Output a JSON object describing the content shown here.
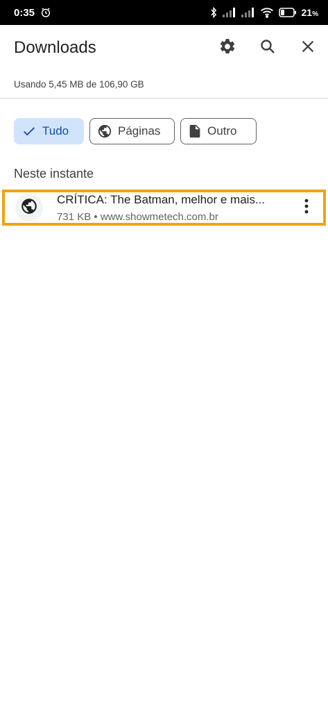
{
  "status_bar": {
    "time": "0:35",
    "battery_percent": "21",
    "battery_unit": "%",
    "icons": [
      "alarm-icon",
      "bluetooth-icon",
      "signal-icon",
      "signal-icon",
      "wifi-icon",
      "battery-icon"
    ]
  },
  "app_bar": {
    "title": "Downloads",
    "actions": [
      "settings-icon",
      "search-icon",
      "close-icon"
    ]
  },
  "storage": {
    "text": "Usando 5,45 MB de 106,90 GB"
  },
  "filters": {
    "chips": [
      {
        "label": "Tudo",
        "icon": "check-icon",
        "selected": true
      },
      {
        "label": "Páginas",
        "icon": "globe-icon",
        "selected": false
      },
      {
        "label": "Outro",
        "icon": "file-icon",
        "selected": false
      }
    ]
  },
  "section": {
    "label": "Neste instante"
  },
  "downloads": [
    {
      "title": "CRÍTICA: The Batman, melhor e mais...",
      "size": "731 KB",
      "separator": "•",
      "source": "www.showmetech.com.br",
      "icon": "globe-icon",
      "highlight_color": "#f0a30a"
    }
  ],
  "colors": {
    "selected_chip_bg": "#d2e3fc",
    "selected_chip_text": "#174ea6",
    "highlight_border": "#f0a30a"
  }
}
